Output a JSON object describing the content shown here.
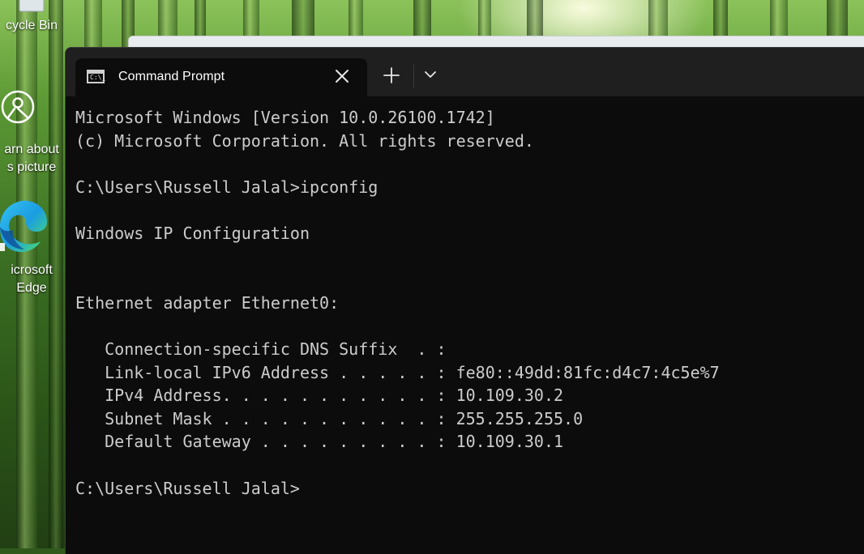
{
  "desktop": {
    "icons": [
      {
        "name": "recycle-bin",
        "label_lines": [
          "cycle Bin"
        ]
      },
      {
        "name": "learn-about-picture",
        "label_lines": [
          "arn about",
          "s picture"
        ]
      },
      {
        "name": "microsoft-edge",
        "label_lines": [
          "icrosoft",
          "Edge"
        ]
      }
    ]
  },
  "window": {
    "tab_title": "Command Prompt",
    "tab_icon_text": "C:\\_",
    "tab_close_icon": "close-icon",
    "new_tab_icon": "plus-icon",
    "dropdown_icon": "chevron-down-icon"
  },
  "console": {
    "lines": [
      "Microsoft Windows [Version 10.0.26100.1742]",
      "(c) Microsoft Corporation. All rights reserved.",
      "",
      "C:\\Users\\Russell Jalal>ipconfig",
      "",
      "Windows IP Configuration",
      "",
      "",
      "Ethernet adapter Ethernet0:",
      "",
      "   Connection-specific DNS Suffix  . :",
      "   Link-local IPv6 Address . . . . . : fe80::49dd:81fc:d4c7:4c5e%7",
      "   IPv4 Address. . . . . . . . . . . : 10.109.30.2",
      "   Subnet Mask . . . . . . . . . . . : 255.255.255.0",
      "   Default Gateway . . . . . . . . . : 10.109.30.1",
      "",
      "C:\\Users\\Russell Jalal>"
    ]
  },
  "colors": {
    "terminal_bg": "#0c0c0c",
    "titlebar_bg": "#1f1f1f",
    "console_text": "#cccccc"
  }
}
